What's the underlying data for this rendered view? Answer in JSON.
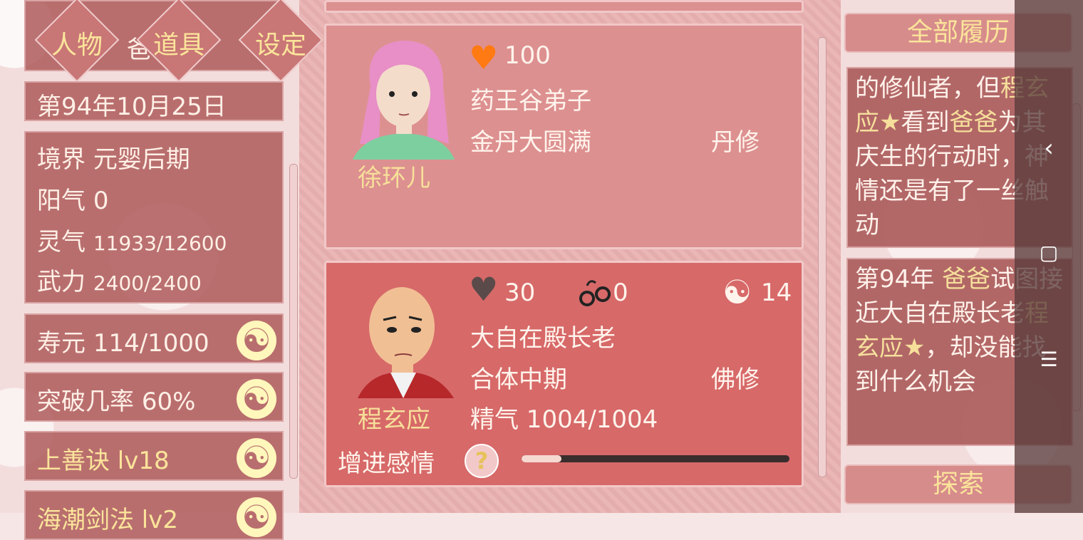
{
  "nav": {
    "tabs": [
      "人物",
      "道具",
      "设定"
    ],
    "top_fragment": "爸"
  },
  "status": {
    "date": "第94年10月25日",
    "realm_label": "境界",
    "realm_value": "元婴后期",
    "yang_label": "阳气",
    "yang_value": "0",
    "spirit_label": "灵气",
    "spirit_value": "11933/12600",
    "force_label": "武力",
    "force_value": "2400/2400",
    "lifespan_label": "寿元",
    "lifespan_value": "114/1000",
    "breakthrough_label": "突破几率",
    "breakthrough_value": "60%",
    "skill1": "上善诀 lv18",
    "skill2": "海潮剑法 lv2"
  },
  "characters": [
    {
      "name": "徐环儿",
      "affection": "100",
      "affection_color": "#ff7a12",
      "sect": "药王谷弟子",
      "realm": "金丹大圆满",
      "path": "丹修"
    },
    {
      "name": "程玄应",
      "affection": "30",
      "affection_color": "#5a4a4a",
      "bond": "0",
      "yinyang": "14",
      "title": "大自在殿长老",
      "realm": "合体中期",
      "path": "佛修",
      "essence": "精气 1004/1004",
      "improve_label": "增进感情",
      "help_icon": "?",
      "progress": 0.15
    }
  ],
  "right": {
    "history_button": "全部履历",
    "explore_button": "探索",
    "log1": {
      "a": "的修仙者，但",
      "b": "程",
      "c": "玄应★",
      "d": "看到",
      "e": "爸爸",
      "f": "为其庆生的行动时，神情还是有了一丝触动"
    },
    "log2": {
      "a": "第94年 ",
      "b": "爸爸",
      "c": "试图接近大自在殿长老",
      "d": "程玄应★",
      "e": "，却没能找到什么机会"
    }
  },
  "icons": {
    "yinyang": "☯",
    "heart": "♥",
    "back": "‹",
    "home": "▢",
    "menu": "☰"
  }
}
